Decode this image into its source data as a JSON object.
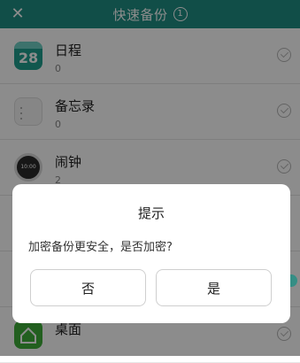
{
  "header": {
    "title": "快速备份",
    "badge": "1",
    "close_icon": "close-icon",
    "color": "#1f8f83"
  },
  "apps": [
    {
      "name": "日程",
      "count": "0",
      "icon": "calendar-icon",
      "icon_text": "28",
      "checked": false
    },
    {
      "name": "备忘录",
      "count": "0",
      "icon": "notes-icon",
      "checked": false
    },
    {
      "name": "闹钟",
      "count": "2",
      "icon": "clock-icon",
      "icon_text": "10:00",
      "checked": false
    },
    {
      "name": "桌面",
      "count": "",
      "icon": "home-icon",
      "checked": false
    }
  ],
  "dialog": {
    "title": "提示",
    "message": "加密备份更安全，是否加密?",
    "no_label": "否",
    "yes_label": "是"
  }
}
